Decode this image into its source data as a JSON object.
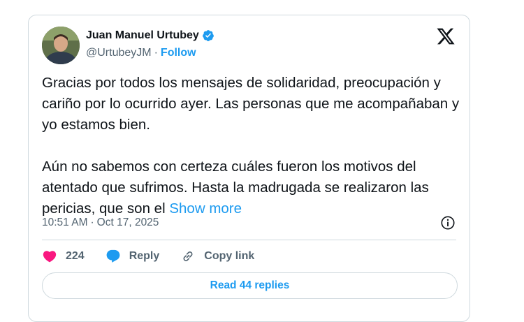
{
  "author": {
    "name": "Juan Manuel Urtubey",
    "handle": "@UrtubeyJM",
    "separator": "·",
    "follow_label": "Follow"
  },
  "tweet": {
    "paragraph1": "Gracias por todos los mensajes de solidaridad, preocupación y cariño por lo ocurrido ayer. Las personas que me acompañaban y yo estamos bien.",
    "paragraph2": "Aún no sabemos con certeza cuáles fueron los motivos del atentado que sufrimos. Hasta la madrugada se realizaron las pericias, que son el",
    "show_more_label": "Show more"
  },
  "meta": {
    "time": "10:51 AM",
    "separator": "·",
    "date": "Oct 17, 2025"
  },
  "actions": {
    "like_count": "224",
    "reply_label": "Reply",
    "copy_link_label": "Copy link"
  },
  "replies_button_label": "Read 44 replies",
  "colors": {
    "accent": "#1d9bf0",
    "like": "#f91880",
    "text": "#0f1419",
    "secondary": "#536471",
    "border": "#cfd9de"
  },
  "icons": [
    "verified-badge-icon",
    "x-logo-icon",
    "info-icon",
    "heart-icon",
    "reply-bubble-icon",
    "link-icon"
  ]
}
